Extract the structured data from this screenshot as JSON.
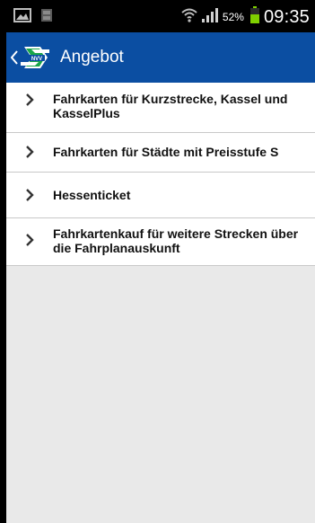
{
  "status_bar": {
    "battery_percent": "52%",
    "time": "09:35",
    "icons": [
      "image-icon",
      "notification-icon",
      "wifi-icon",
      "signal-icon",
      "battery-icon"
    ]
  },
  "action_bar": {
    "title": "Angebot",
    "logo_text": "NVV"
  },
  "menu": {
    "items": [
      {
        "label": "Fahrkarten für Kurzstrecke, Kassel und KasselPlus"
      },
      {
        "label": "Fahrkarten für Städte mit Preisstufe S"
      },
      {
        "label": "Hessenticket"
      },
      {
        "label": "Fahrkartenkauf für weitere Strecken über die Fahrplanauskunft"
      }
    ]
  },
  "colors": {
    "action_bar": "#0b4ea2",
    "battery": "#7fd000",
    "background": "#e9e9e9"
  }
}
